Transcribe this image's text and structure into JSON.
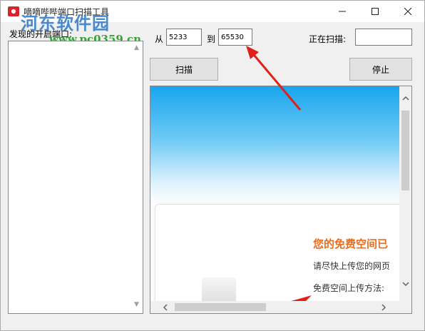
{
  "window": {
    "title": "嘀嘀哔哔端口扫描工具",
    "icon": "app-icon"
  },
  "watermark": {
    "name": "河东软件园",
    "url": "www.pc0359.cn"
  },
  "left_panel": {
    "label": "发现的开启端口:"
  },
  "range": {
    "from_label": "从",
    "from_value": "5233",
    "to_label": "到",
    "to_value": "65530"
  },
  "scanning": {
    "label": "正在扫描:",
    "value": ""
  },
  "buttons": {
    "scan": "扫描",
    "stop": "停止"
  },
  "browser": {
    "headline": "您的免费空间已",
    "line1": "请尽快上传您的网页",
    "line2": "免费空间上传方法:"
  },
  "colors": {
    "headline": "#ee6b1a",
    "annotation_arrow": "#e0201b",
    "banner_blue": "#18a6ee"
  }
}
